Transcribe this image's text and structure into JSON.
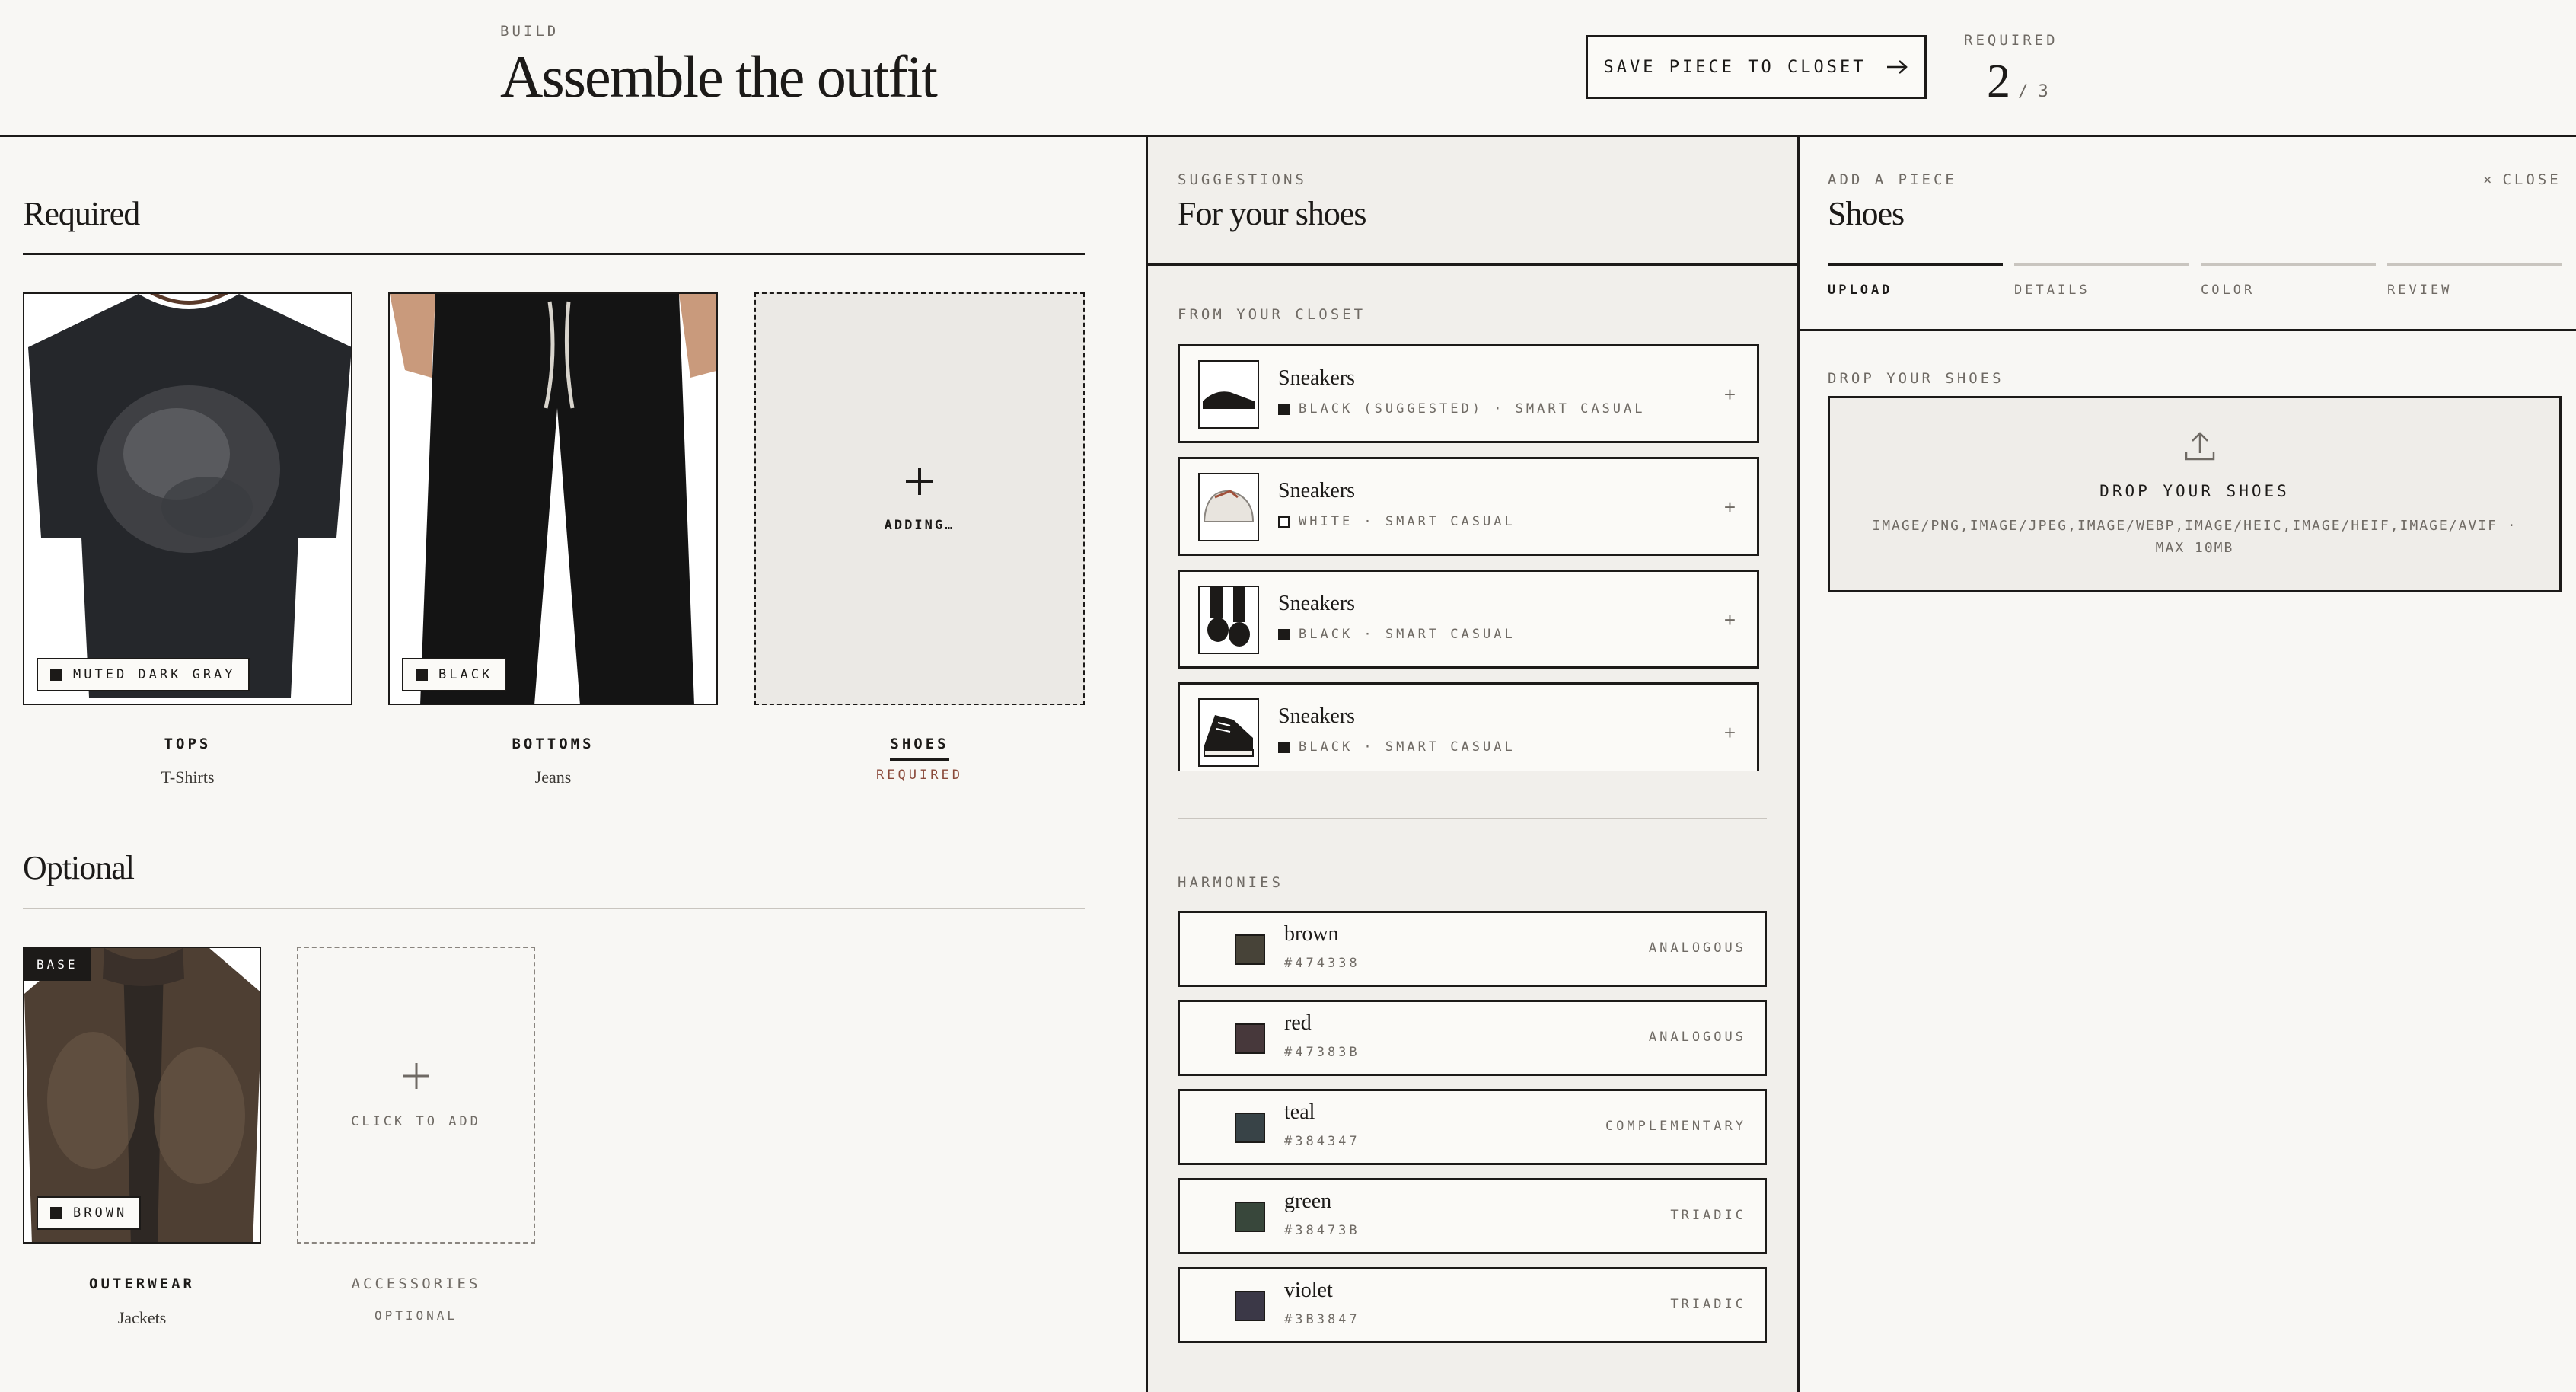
{
  "header": {
    "eyebrow": "BUILD",
    "title": "Assemble the outfit",
    "save_label": "SAVE PIECE TO CLOSET",
    "required_label": "REQUIRED",
    "required_count": "2",
    "required_total": "/ 3"
  },
  "required": {
    "title": "Required",
    "items": [
      {
        "category": "TOPS",
        "sub": "T-Shirts",
        "tag": "MUTED DARK GRAY"
      },
      {
        "category": "BOTTOMS",
        "sub": "Jeans",
        "tag": "BLACK"
      },
      {
        "category": "SHOES",
        "sub": "REQUIRED",
        "empty_label": "ADDING…"
      }
    ]
  },
  "optional": {
    "title": "Optional",
    "items": [
      {
        "category": "OUTERWEAR",
        "sub": "Jackets",
        "tag": "BROWN",
        "badge": "BASE"
      },
      {
        "category": "ACCESSORIES",
        "sub": "OPTIONAL",
        "empty_label": "CLICK TO ADD"
      }
    ]
  },
  "suggestions": {
    "eyebrow": "SUGGESTIONS",
    "title": "For your shoes",
    "closet_label": "FROM YOUR CLOSET",
    "items": [
      {
        "name": "Sneakers",
        "meta": "BLACK (SUGGESTED) · SMART CASUAL",
        "swatch": "#1c1a18"
      },
      {
        "name": "Sneakers",
        "meta": "WHITE · SMART CASUAL",
        "swatch": "#ffffff"
      },
      {
        "name": "Sneakers",
        "meta": "BLACK · SMART CASUAL",
        "swatch": "#1c1a18"
      },
      {
        "name": "Sneakers",
        "meta": "BLACK · SMART CASUAL",
        "swatch": "#1c1a18"
      }
    ],
    "harmonies_label": "HARMONIES",
    "harmonies": [
      {
        "name": "brown",
        "hex": "#474338",
        "type": "ANALOGOUS"
      },
      {
        "name": "red",
        "hex": "#47383B",
        "type": "ANALOGOUS"
      },
      {
        "name": "teal",
        "hex": "#384347",
        "type": "COMPLEMENTARY"
      },
      {
        "name": "green",
        "hex": "#38473B",
        "type": "TRIADIC"
      },
      {
        "name": "violet",
        "hex": "#3B3847",
        "type": "TRIADIC"
      }
    ]
  },
  "add_piece": {
    "eyebrow": "ADD A PIECE",
    "close_label": "CLOSE",
    "title": "Shoes",
    "tabs": [
      "UPLOAD",
      "DETAILS",
      "COLOR",
      "REVIEW"
    ],
    "active_tab": "UPLOAD",
    "drop_label": "DROP YOUR SHOES",
    "drop_title": "DROP YOUR SHOES",
    "drop_types": "IMAGE/PNG,IMAGE/JPEG,IMAGE/WEBP,IMAGE/HEIC,IMAGE/HEIF,IMAGE/AVIF ·",
    "drop_max": "MAX 10MB"
  },
  "colors": {
    "ink": "#1c1a18",
    "paper": "#f8f7f4",
    "accent": "#8a4a3a",
    "muted": "#6f6a64"
  },
  "icons": [
    "arrow-right-icon",
    "plus-icon",
    "close-icon",
    "upload-icon"
  ]
}
